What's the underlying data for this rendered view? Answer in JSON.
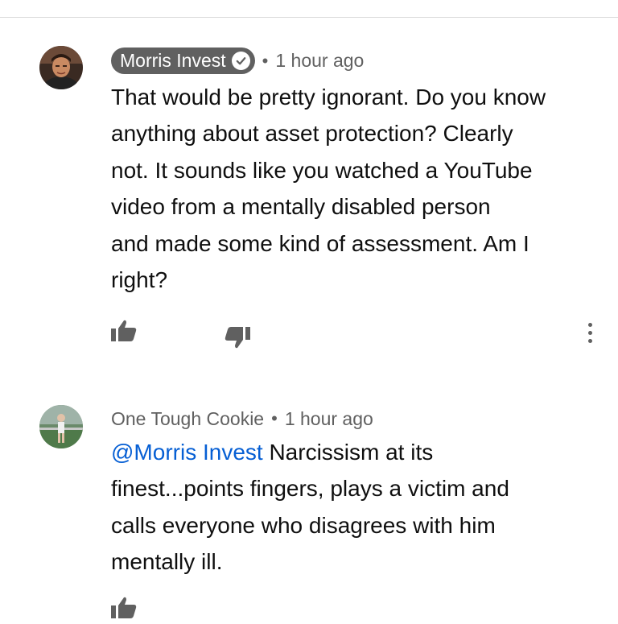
{
  "comments": [
    {
      "author": "Morris Invest",
      "verified": true,
      "separator": "•",
      "time": "1 hour ago",
      "lines": [
        "That would be pretty ignorant. Do you know",
        "anything about asset protection? Clearly",
        "not. It sounds like you watched a YouTube",
        "video from a mentally disabled person",
        "and made some kind of assessment. Am I",
        "right?"
      ]
    },
    {
      "author": "One Tough Cookie",
      "separator": "•",
      "time": "1 hour ago",
      "mention": "@Morris Invest",
      "first_line_rest": " Narcissism at its",
      "lines": [
        "finest...points fingers, plays a victim and",
        "calls everyone who disagrees with him",
        "mentally ill."
      ]
    }
  ],
  "icons": {
    "like": "thumbs-up-icon",
    "dislike": "thumbs-down-icon",
    "menu": "more-vertical-icon"
  },
  "colors": {
    "chip_bg": "#606060",
    "meta_text": "#606060",
    "mention": "#065fd4",
    "icon": "#606060"
  }
}
